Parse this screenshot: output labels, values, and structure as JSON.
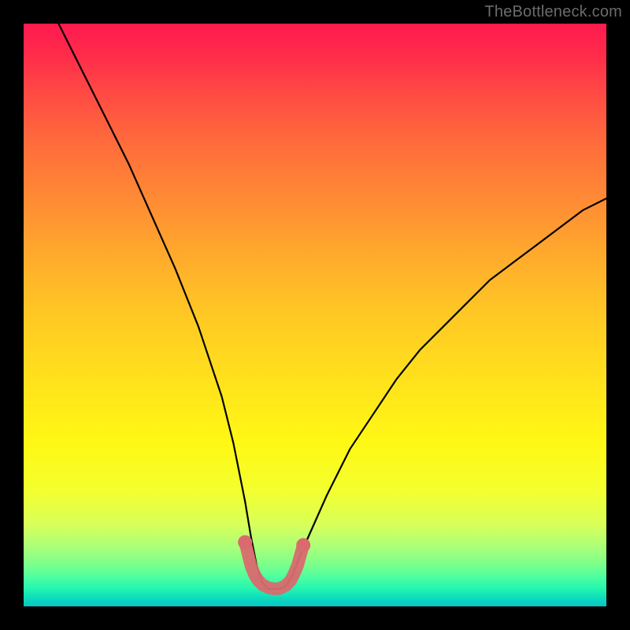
{
  "watermark": "TheBottleneck.com",
  "chart_data": {
    "type": "line",
    "title": "",
    "xlabel": "",
    "ylabel": "",
    "xlim": [
      0,
      100
    ],
    "ylim": [
      0,
      100
    ],
    "series": [
      {
        "name": "bottleneck-curve",
        "x": [
          6,
          10,
          14,
          18,
          22,
          26,
          30,
          34,
          36,
          38,
          39,
          40,
          41,
          42,
          43,
          44,
          45,
          46,
          48,
          52,
          56,
          60,
          64,
          68,
          72,
          76,
          80,
          84,
          88,
          92,
          96,
          100
        ],
        "y": [
          100,
          92,
          84,
          76,
          67,
          58,
          48,
          36,
          28,
          18,
          12,
          7,
          4,
          3,
          3,
          3,
          3.5,
          5,
          10,
          19,
          27,
          33,
          39,
          44,
          48,
          52,
          56,
          59,
          62,
          65,
          68,
          70
        ]
      },
      {
        "name": "trough-marker",
        "x": [
          38.0,
          38.5,
          39.0,
          39.6,
          40.2,
          41.0,
          42.0,
          43.0,
          44.0,
          45.0,
          45.8,
          46.4,
          47.0,
          47.5,
          48.0
        ],
        "y": [
          11.0,
          9.0,
          7.0,
          5.5,
          4.5,
          3.7,
          3.2,
          3.0,
          3.1,
          3.6,
          4.4,
          5.6,
          7.0,
          8.8,
          10.5
        ]
      }
    ],
    "gradient_stops": [
      {
        "pos": 0,
        "color": "#ff1a4f"
      },
      {
        "pos": 50,
        "color": "#ffc824"
      },
      {
        "pos": 80,
        "color": "#f4ff2e"
      },
      {
        "pos": 95,
        "color": "#4cffa0"
      },
      {
        "pos": 100,
        "color": "#06c6c6"
      }
    ]
  }
}
